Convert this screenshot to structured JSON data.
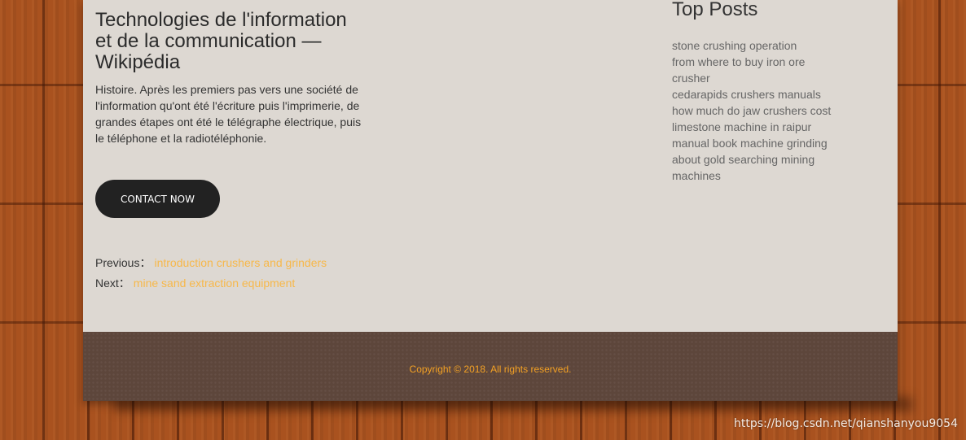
{
  "article": {
    "title": "Technologies de l'information et de la communication — Wikipédia",
    "body": "Histoire. Après les premiers pas vers une société de l'information qu'ont été l'écriture puis l'imprimerie, de grandes étapes ont été le télégraphe électrique, puis le téléphone et la radiotéléphonie.",
    "contact_label": "CONTACT NOW"
  },
  "post_nav": {
    "previous_label": "Previous：",
    "previous_link": "introduction crushers and grinders",
    "next_label": "Next：",
    "next_link": "mine sand extraction equipment"
  },
  "sidebar": {
    "title": "Top Posts",
    "items": [
      "stone crushing operation",
      "from where to buy iron ore crusher",
      "cedarapids crushers manuals",
      "how much do jaw crushers cost",
      "limestone machine in raipur",
      "manual book machine grinding",
      "about gold searching mining machines"
    ]
  },
  "footer": {
    "copyright": "Copyright © 2018. All rights reserved."
  },
  "watermark": "https://blog.csdn.net/qianshanyou9054",
  "colors": {
    "content_bg": "#ddd8d2",
    "footer_bg": "#5d463b",
    "link_accent": "#f7b84a",
    "copyright": "#f3a124",
    "button_bg": "#222222",
    "wood": "#a9521f"
  }
}
